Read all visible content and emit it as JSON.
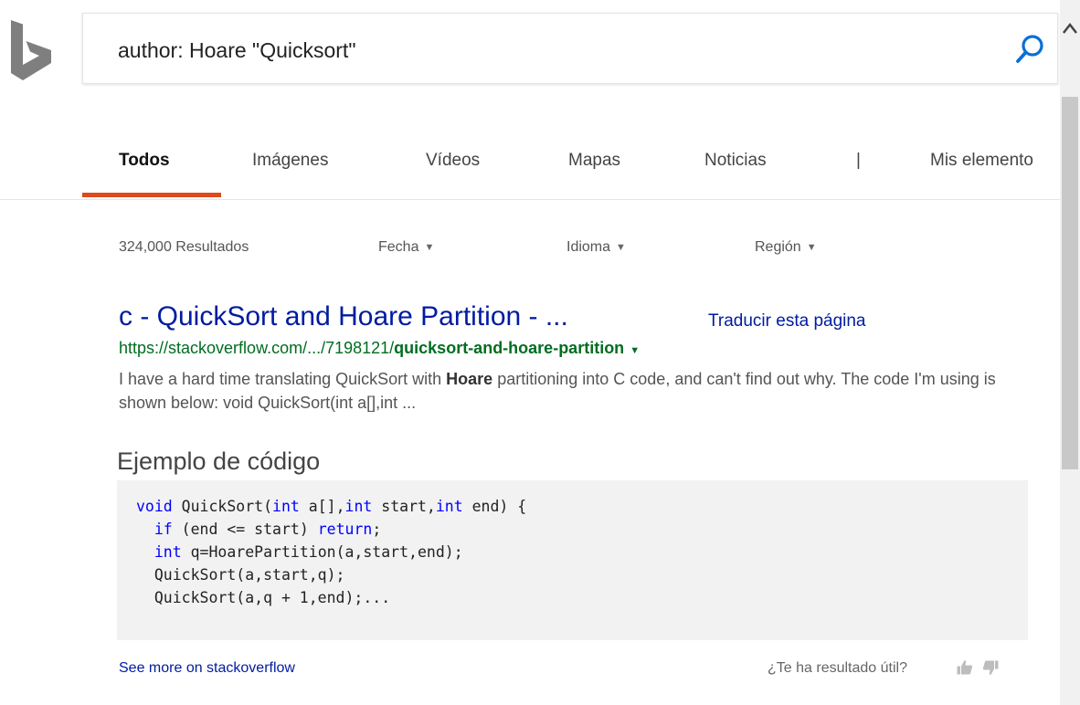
{
  "search": {
    "query": "author: Hoare \"Quicksort\""
  },
  "tabs": [
    {
      "label": "Todos"
    },
    {
      "label": "Imágenes"
    },
    {
      "label": "Vídeos"
    },
    {
      "label": "Mapas"
    },
    {
      "label": "Noticias"
    },
    {
      "label": "Mis elemento"
    }
  ],
  "tab_separator": "|",
  "meta": {
    "result_count": "324,000 Resultados",
    "filters": [
      "Fecha",
      "Idioma",
      "Región"
    ]
  },
  "result": {
    "title": "c - QuickSort and Hoare Partition - ...",
    "translate": "Traducir esta página",
    "url_prefix": "https://stackoverflow.com/.../7198121/",
    "url_bold": "quicksort-and-hoare-partition",
    "snippet_part1": "I have a hard time translating QuickSort with ",
    "snippet_bold": "Hoare",
    "snippet_part2": " partitioning into C code, and can't find out why. The code I'm using is shown below: void QuickSort(int a[],int ..."
  },
  "code_example": {
    "heading": "Ejemplo de código",
    "lines": [
      [
        {
          "t": "void",
          "k": 1
        },
        {
          "t": " QuickSort("
        },
        {
          "t": "int",
          "k": 1
        },
        {
          "t": " a[],"
        },
        {
          "t": "int",
          "k": 1
        },
        {
          "t": " start,"
        },
        {
          "t": "int",
          "k": 1
        },
        {
          "t": " end) {"
        }
      ],
      [
        {
          "t": "  "
        },
        {
          "t": "if",
          "k": 1
        },
        {
          "t": " (end <= start) "
        },
        {
          "t": "return",
          "k": 1
        },
        {
          "t": ";"
        }
      ],
      [
        {
          "t": "  "
        },
        {
          "t": "int",
          "k": 1
        },
        {
          "t": " q=HoarePartition(a,start,end);"
        }
      ],
      [
        {
          "t": "  QuickSort(a,start,q);"
        }
      ],
      [
        {
          "t": "  QuickSort(a,q + 1,end);..."
        }
      ]
    ]
  },
  "footer": {
    "see_more": "See more on stackoverflow",
    "useful": "¿Te ha resultado útil?"
  },
  "colors": {
    "accent": "#de4a1d",
    "link": "#001ba0",
    "url": "#006d21",
    "keyword": "#0000ff"
  }
}
